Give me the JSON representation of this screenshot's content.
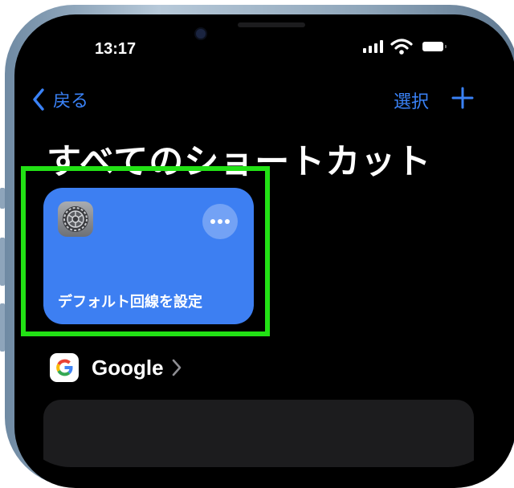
{
  "status_bar": {
    "time": "13:17"
  },
  "nav": {
    "back_label": "戻る",
    "select_label": "選択"
  },
  "page": {
    "title": "すべてのショートカット"
  },
  "shortcut": {
    "label": "デフォルト回線を設定",
    "icon": "settings-gear-icon",
    "color": "#3d7ff2"
  },
  "folder": {
    "label": "Google"
  },
  "colors": {
    "accent": "#3a82f7",
    "highlight": "#22e115",
    "background": "#000000"
  }
}
